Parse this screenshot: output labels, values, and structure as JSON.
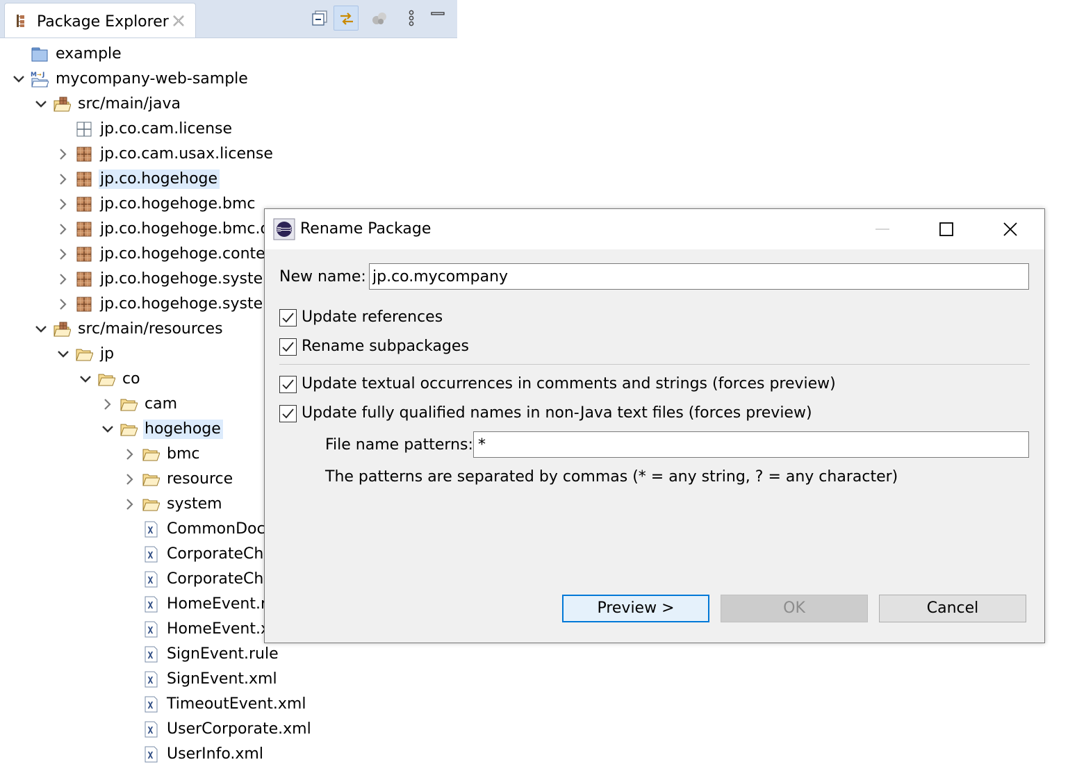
{
  "explorer": {
    "tab_label": "Package Explorer",
    "toolbar": [
      "collapse-all-icon",
      "link-with-editor-icon",
      "focus-on-active-task-icon",
      "view-menu-icon",
      "minimize-icon"
    ],
    "tree": [
      {
        "label": "example",
        "depth": 0,
        "icon": "folder",
        "twisty": "none"
      },
      {
        "label": "mycompany-web-sample",
        "depth": 0,
        "icon": "project",
        "twisty": "open"
      },
      {
        "label": "src/main/java",
        "depth": 1,
        "icon": "source-folder",
        "twisty": "open"
      },
      {
        "label": "jp.co.cam.license",
        "depth": 2,
        "icon": "package-empty",
        "twisty": "none"
      },
      {
        "label": "jp.co.cam.usax.license",
        "depth": 2,
        "icon": "package",
        "twisty": "closed"
      },
      {
        "label": "jp.co.hogehoge",
        "depth": 2,
        "icon": "package",
        "twisty": "closed",
        "selected": true
      },
      {
        "label": "jp.co.hogehoge.bmc",
        "depth": 2,
        "icon": "package",
        "twisty": "closed"
      },
      {
        "label": "jp.co.hogehoge.bmc.d",
        "depth": 2,
        "icon": "package",
        "twisty": "closed"
      },
      {
        "label": "jp.co.hogehoge.contex",
        "depth": 2,
        "icon": "package",
        "twisty": "closed"
      },
      {
        "label": "jp.co.hogehoge.systen",
        "depth": 2,
        "icon": "package",
        "twisty": "closed"
      },
      {
        "label": "jp.co.hogehoge.systen",
        "depth": 2,
        "icon": "package",
        "twisty": "closed"
      },
      {
        "label": "src/main/resources",
        "depth": 1,
        "icon": "source-folder",
        "twisty": "open"
      },
      {
        "label": "jp",
        "depth": 2,
        "icon": "folder-open",
        "twisty": "open"
      },
      {
        "label": "co",
        "depth": 3,
        "icon": "folder-open",
        "twisty": "open"
      },
      {
        "label": "cam",
        "depth": 4,
        "icon": "folder-open",
        "twisty": "closed"
      },
      {
        "label": "hogehoge",
        "depth": 4,
        "icon": "folder-open",
        "twisty": "open",
        "selected": true
      },
      {
        "label": "bmc",
        "depth": 5,
        "icon": "folder-open",
        "twisty": "closed"
      },
      {
        "label": "resource",
        "depth": 5,
        "icon": "folder-open",
        "twisty": "closed"
      },
      {
        "label": "system",
        "depth": 5,
        "icon": "folder-open",
        "twisty": "closed"
      },
      {
        "label": "CommonDoc",
        "depth": 5,
        "icon": "xml-file",
        "twisty": "none"
      },
      {
        "label": "CorporateCha",
        "depth": 5,
        "icon": "xml-file",
        "twisty": "none"
      },
      {
        "label": "CorporateCha",
        "depth": 5,
        "icon": "xml-file",
        "twisty": "none"
      },
      {
        "label": "HomeEvent.r",
        "depth": 5,
        "icon": "xml-file",
        "twisty": "none"
      },
      {
        "label": "HomeEvent.x",
        "depth": 5,
        "icon": "xml-file",
        "twisty": "none"
      },
      {
        "label": "SignEvent.rule",
        "depth": 5,
        "icon": "xml-file",
        "twisty": "none"
      },
      {
        "label": "SignEvent.xml",
        "depth": 5,
        "icon": "xml-file",
        "twisty": "none"
      },
      {
        "label": "TimeoutEvent.xml",
        "depth": 5,
        "icon": "xml-file",
        "twisty": "none"
      },
      {
        "label": "UserCorporate.xml",
        "depth": 5,
        "icon": "xml-file",
        "twisty": "none"
      },
      {
        "label": "UserInfo.xml",
        "depth": 5,
        "icon": "xml-file",
        "twisty": "none"
      }
    ]
  },
  "dialog": {
    "title": "Rename Package",
    "new_name_label": "New name:",
    "new_name_value": "jp.co.mycompany",
    "update_references": {
      "label": "Update references",
      "checked": true
    },
    "rename_subpackages": {
      "label": "Rename subpackages",
      "checked": true
    },
    "update_textual": {
      "label": "Update textual occurrences in comments and strings (forces preview)",
      "checked": true
    },
    "update_qualified": {
      "label": "Update fully qualified names in non-Java text files (forces preview)",
      "checked": true
    },
    "file_patterns_label": "File name patterns:",
    "file_patterns_value": "*",
    "patterns_hint": "The patterns are separated by commas (* = any string, ? = any character)",
    "preview_label": "Preview >",
    "ok_label": "OK",
    "cancel_label": "Cancel",
    "ok_enabled": false
  },
  "colors": {
    "selection": "#dcebfc",
    "header": "#dae3f0",
    "folder": "#f3c86a",
    "package": "#b5744f",
    "accent": "#0078d7"
  }
}
